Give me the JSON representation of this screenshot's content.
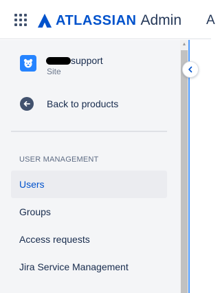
{
  "header": {
    "brand": "ATLASSIAN",
    "product": "Admin",
    "right_partial_text": "A",
    "brand_color": "#0052cc"
  },
  "sidebar": {
    "site": {
      "name_visible": "support",
      "name_redacted": true,
      "subtitle": "Site"
    },
    "back_label": "Back to products",
    "section_title": "USER MANAGEMENT",
    "items": [
      {
        "label": "Users",
        "active": true
      },
      {
        "label": "Groups",
        "active": false
      },
      {
        "label": "Access requests",
        "active": false
      },
      {
        "label": "Jira Service Management",
        "active": false
      }
    ]
  },
  "icons": {
    "app_switcher": "grid-icon",
    "logo": "atlassian-logo-icon",
    "site": "site-bear-icon",
    "back": "arrow-left-icon",
    "collapse": "chevron-left-icon"
  },
  "colors": {
    "sidebar_bg": "#f4f5f7",
    "active_item_bg": "#ebecf0",
    "active_item_text": "#0052cc",
    "divider_accent": "#4c9aff"
  }
}
